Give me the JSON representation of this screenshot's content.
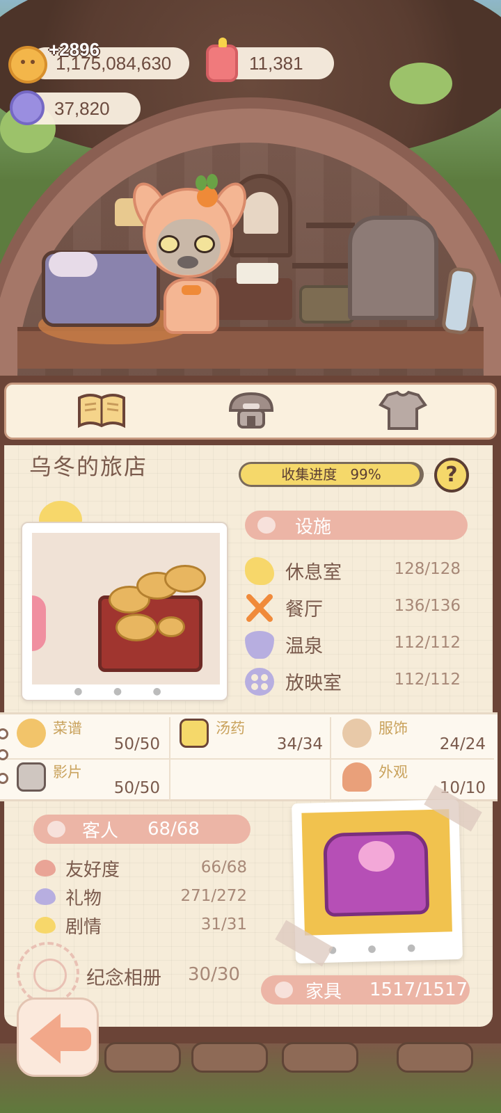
{
  "currency": {
    "coins": "1,175,084,630",
    "coins_delta": "+2896",
    "gems": "11,381",
    "crystals": "37,820"
  },
  "tabs": [
    {
      "name": "book",
      "icon": "open-book-icon"
    },
    {
      "name": "hotel",
      "icon": "mushroom-hotel-icon"
    },
    {
      "name": "outfit",
      "icon": "shirt-icon"
    }
  ],
  "hotel": {
    "title": "乌冬的旅店",
    "progress_label": "收集进度",
    "progress_value": "99%",
    "progress_fraction": 0.99,
    "help": "?"
  },
  "facilities": {
    "header": "设施",
    "items": [
      {
        "label": "休息室",
        "value": "128/128",
        "icon": "cloud-icon",
        "color": "#f7d76a"
      },
      {
        "label": "餐厅",
        "value": "136/136",
        "icon": "fork-knife-icon",
        "color": "#f08a3a"
      },
      {
        "label": "温泉",
        "value": "112/112",
        "icon": "hot-spring-icon",
        "color": "#b7aee0"
      },
      {
        "label": "放映室",
        "value": "112/112",
        "icon": "film-reel-icon",
        "color": "#b7aee0"
      }
    ]
  },
  "collections": [
    {
      "label": "菜谱",
      "value": "50/50",
      "icon": "recipe-icon"
    },
    {
      "label": "汤药",
      "value": "34/34",
      "icon": "potion-icon"
    },
    {
      "label": "服饰",
      "value": "24/24",
      "icon": "costume-icon"
    },
    {
      "label": "影片",
      "value": "50/50",
      "icon": "clapperboard-icon"
    },
    {
      "label": "外观",
      "value": "10/10",
      "icon": "house-icon"
    }
  ],
  "guests": {
    "header": "客人",
    "header_value": "68/68",
    "items": [
      {
        "label": "友好度",
        "value": "66/68",
        "icon": "heart-icon",
        "color": "#e9a496"
      },
      {
        "label": "礼物",
        "value": "271/272",
        "icon": "heart-icon",
        "color": "#b7aee0"
      },
      {
        "label": "剧情",
        "value": "31/31",
        "icon": "heart-icon",
        "color": "#f7d76a"
      }
    ]
  },
  "album": {
    "label": "纪念相册",
    "value": "30/30"
  },
  "furniture": {
    "label": "家具",
    "value": "1517/1517"
  },
  "colors": {
    "accent_banner": "#ecb5a6",
    "paper": "#f6ecd9",
    "frame": "#6b4437",
    "progress": "#f5d86a"
  }
}
